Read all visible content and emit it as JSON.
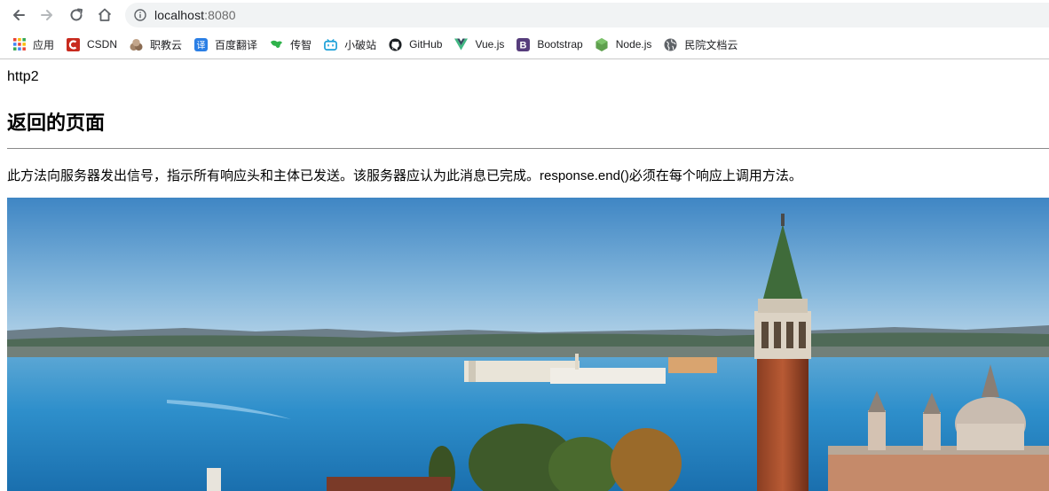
{
  "browser": {
    "url_host": "localhost",
    "url_port": ":8080",
    "bookmarks": [
      {
        "label": "应用",
        "icon": "apps-grid-icon"
      },
      {
        "label": "CSDN",
        "icon": "csdn-icon",
        "color": "#c82a1e"
      },
      {
        "label": "职教云",
        "icon": "zhijiaoyun-icon"
      },
      {
        "label": "百度翻译",
        "icon": "baidu-translate-icon",
        "color": "#2b7fe5"
      },
      {
        "label": "传智",
        "icon": "chuanzhi-icon",
        "color": "#2fb24b"
      },
      {
        "label": "小破站",
        "icon": "bilibili-icon",
        "color": "#1aa0d8"
      },
      {
        "label": "GitHub",
        "icon": "github-icon"
      },
      {
        "label": "Vue.js",
        "icon": "vue-icon",
        "color": "#42b883"
      },
      {
        "label": "Bootstrap",
        "icon": "bootstrap-icon",
        "color": "#563d7c"
      },
      {
        "label": "Node.js",
        "icon": "nodejs-icon",
        "color": "#5fa04e"
      },
      {
        "label": "民院文档云",
        "icon": "globe-icon"
      }
    ]
  },
  "page": {
    "line1": "http2",
    "heading": "返回的页面",
    "paragraph": "此方法向服务器发出信号，指示所有响应头和主体已发送。该服务器应认为此消息已完成。response.end()必须在每个响应上调用方法。"
  }
}
